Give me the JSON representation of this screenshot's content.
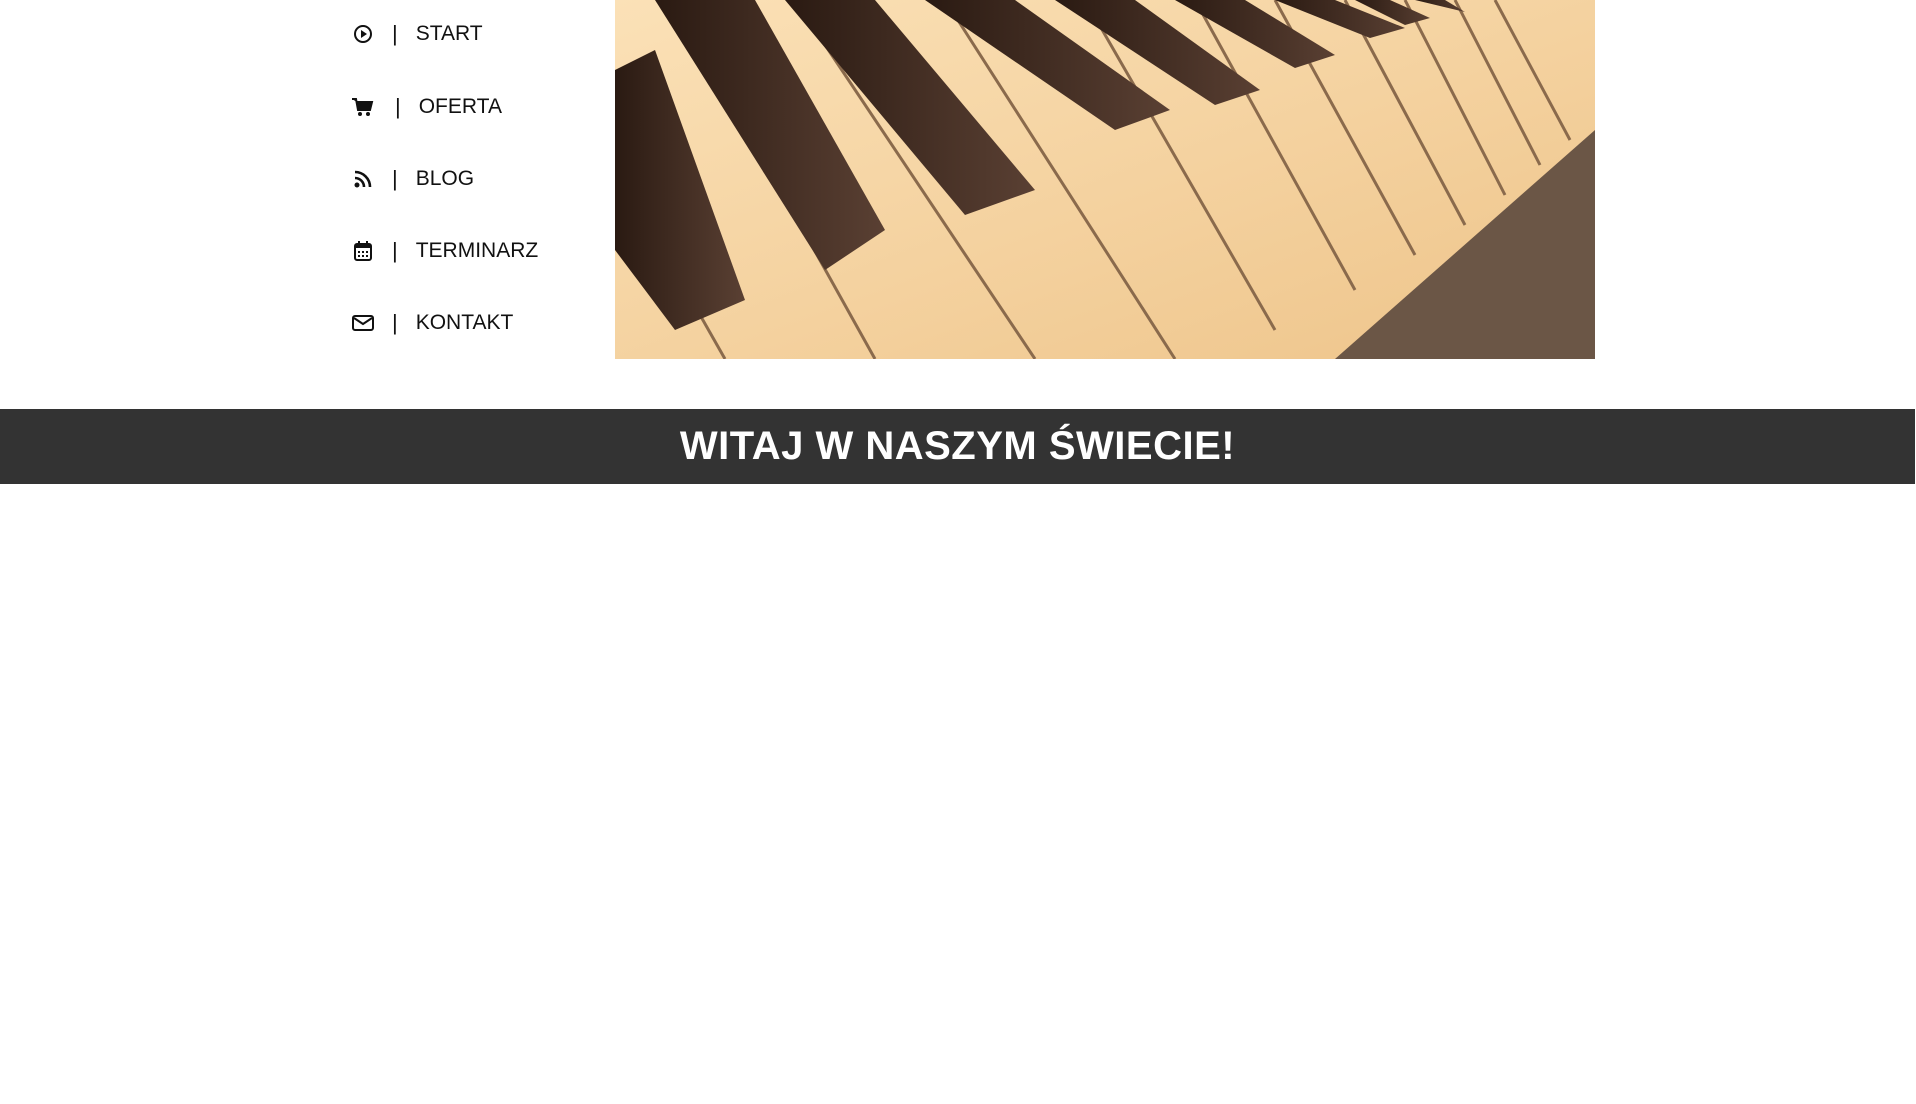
{
  "nav": {
    "items": [
      {
        "label": "START",
        "icon": "play-circle-icon"
      },
      {
        "label": "OFERTA",
        "icon": "cart-icon"
      },
      {
        "label": "BLOG",
        "icon": "rss-icon"
      },
      {
        "label": "TERMINARZ",
        "icon": "calendar-icon"
      },
      {
        "label": "KONTAKT",
        "icon": "envelope-icon"
      }
    ],
    "separator": "|"
  },
  "hero": {
    "image": "piano-keys-sepia"
  },
  "banner": {
    "title": "WITAJ W NASZYM ŚWIECIE!"
  },
  "colors": {
    "banner_bg": "#333333",
    "banner_text": "#ffffff"
  }
}
